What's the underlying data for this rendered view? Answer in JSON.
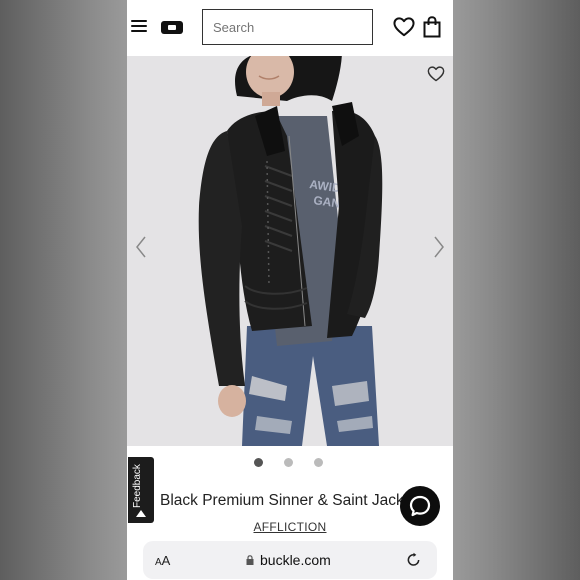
{
  "header": {
    "search_placeholder": "Search"
  },
  "icons": {
    "menu": "hamburger-menu-icon",
    "logo": "buckle-logo-icon",
    "wishlist": "heart-icon",
    "bag": "shopping-bag-icon",
    "save": "heart-outline-icon",
    "prev": "chevron-left-icon",
    "next": "chevron-right-icon",
    "chat": "chat-bubble-icon",
    "lock": "lock-icon",
    "reload": "reload-icon"
  },
  "product": {
    "title": "Black Premium Sinner & Saint Jacket",
    "brand": "AFFLICTION",
    "image_dots_total": 3,
    "image_dots_active": 1
  },
  "feedback_tab": {
    "label": "Feedback"
  },
  "browser": {
    "text_size_label_small": "A",
    "text_size_label_large": "A",
    "url": "buckle.com"
  },
  "colors": {
    "page_bg": "#ffffff",
    "photo_bg": "#e4e3e5",
    "dark": "#111111"
  }
}
